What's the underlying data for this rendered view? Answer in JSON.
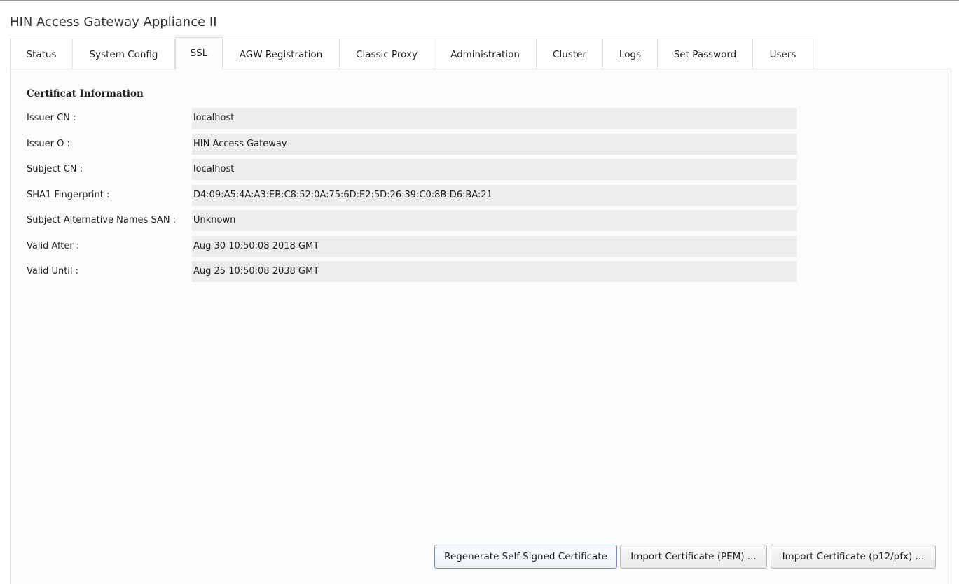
{
  "app": {
    "title": "HIN Access Gateway Appliance II"
  },
  "tabs": [
    {
      "label": "Status",
      "active": false
    },
    {
      "label": "System Config",
      "active": false
    },
    {
      "label": "SSL",
      "active": true
    },
    {
      "label": "AGW Registration",
      "active": false
    },
    {
      "label": "Classic Proxy",
      "active": false
    },
    {
      "label": "Administration",
      "active": false
    },
    {
      "label": "Cluster",
      "active": false
    },
    {
      "label": "Logs",
      "active": false
    },
    {
      "label": "Set Password",
      "active": false
    },
    {
      "label": "Users",
      "active": false
    }
  ],
  "certificate": {
    "section_title": "Certificat Information",
    "fields": [
      {
        "label": "Issuer CN :",
        "value": "localhost"
      },
      {
        "label": "Issuer O :",
        "value": "HIN Access Gateway"
      },
      {
        "label": "Subject CN :",
        "value": "localhost"
      },
      {
        "label": "SHA1 Fingerprint :",
        "value": "D4:09:A5:4A:A3:EB:C8:52:0A:75:6D:E2:5D:26:39:C0:8B:D6:BA:21"
      },
      {
        "label": "Subject Alternative Names SAN :",
        "value": "Unknown"
      },
      {
        "label": "Valid After :",
        "value": "Aug 30 10:50:08 2018 GMT"
      },
      {
        "label": "Valid Until :",
        "value": "Aug 25 10:50:08 2038 GMT"
      }
    ]
  },
  "actions": {
    "regenerate_label": "Regenerate Self-Signed Certificate",
    "import_pem_label": "Import Certificate (PEM) ...",
    "import_p12_label": "Import Certificate (p12/pfx) ..."
  },
  "colors": {
    "panel_background": "#fcfcfc",
    "field_background": "#ececec",
    "primary_button_border": "#6f93c9"
  }
}
